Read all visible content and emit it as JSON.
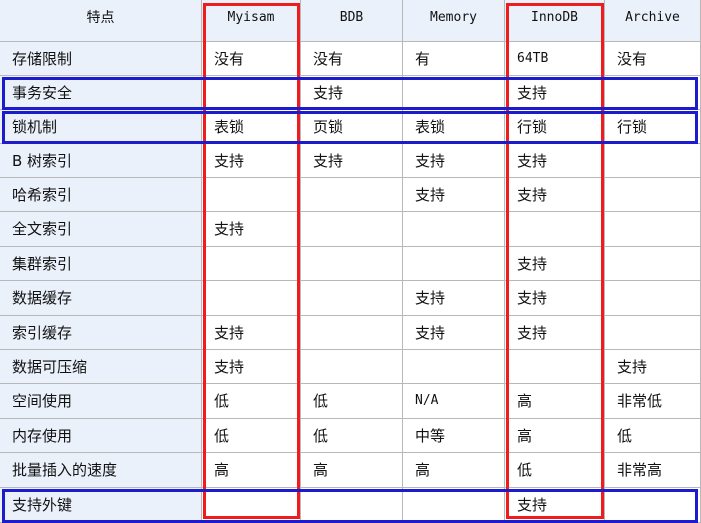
{
  "table": {
    "header": [
      "特点",
      "Myisam",
      "BDB",
      "Memory",
      "InnoDB",
      "Archive"
    ],
    "rows": [
      [
        "存储限制",
        "没有",
        "没有",
        "有",
        "64TB",
        "没有"
      ],
      [
        "事务安全",
        "",
        "支持",
        "",
        "支持",
        ""
      ],
      [
        "锁机制",
        "表锁",
        "页锁",
        "表锁",
        "行锁",
        "行锁"
      ],
      [
        "B 树索引",
        "支持",
        "支持",
        "支持",
        "支持",
        ""
      ],
      [
        "哈希索引",
        "",
        "",
        "支持",
        "支持",
        ""
      ],
      [
        "全文索引",
        "支持",
        "",
        "",
        "",
        ""
      ],
      [
        "集群索引",
        "",
        "",
        "",
        "支持",
        ""
      ],
      [
        "数据缓存",
        "",
        "",
        "支持",
        "支持",
        ""
      ],
      [
        "索引缓存",
        "支持",
        "",
        "支持",
        "支持",
        ""
      ],
      [
        "数据可压缩",
        "支持",
        "",
        "",
        "",
        "支持"
      ],
      [
        "空间使用",
        "低",
        "低",
        "N/A",
        "高",
        "非常低"
      ],
      [
        "内存使用",
        "低",
        "低",
        "中等",
        "高",
        "低"
      ],
      [
        "批量插入的速度",
        "高",
        "高",
        "高",
        "低",
        "非常高"
      ],
      [
        "支持外键",
        "",
        "",
        "",
        "支持",
        ""
      ]
    ]
  },
  "highlights": {
    "column_boxes": [
      {
        "column": "Myisam",
        "color": "#ee1c1c"
      },
      {
        "column": "InnoDB",
        "color": "#ee1c1c"
      }
    ],
    "row_boxes": [
      {
        "row": "事务安全",
        "color": "#1c1ccc"
      },
      {
        "row": "锁机制",
        "color": "#1c1ccc"
      },
      {
        "row": "支持外键",
        "color": "#1c1ccc"
      }
    ]
  },
  "colors": {
    "header_bg": "#eaf1fb",
    "grid_line": "#b8b8b8",
    "column_highlight": "#ee1c1c",
    "row_highlight": "#1c1ccc"
  }
}
